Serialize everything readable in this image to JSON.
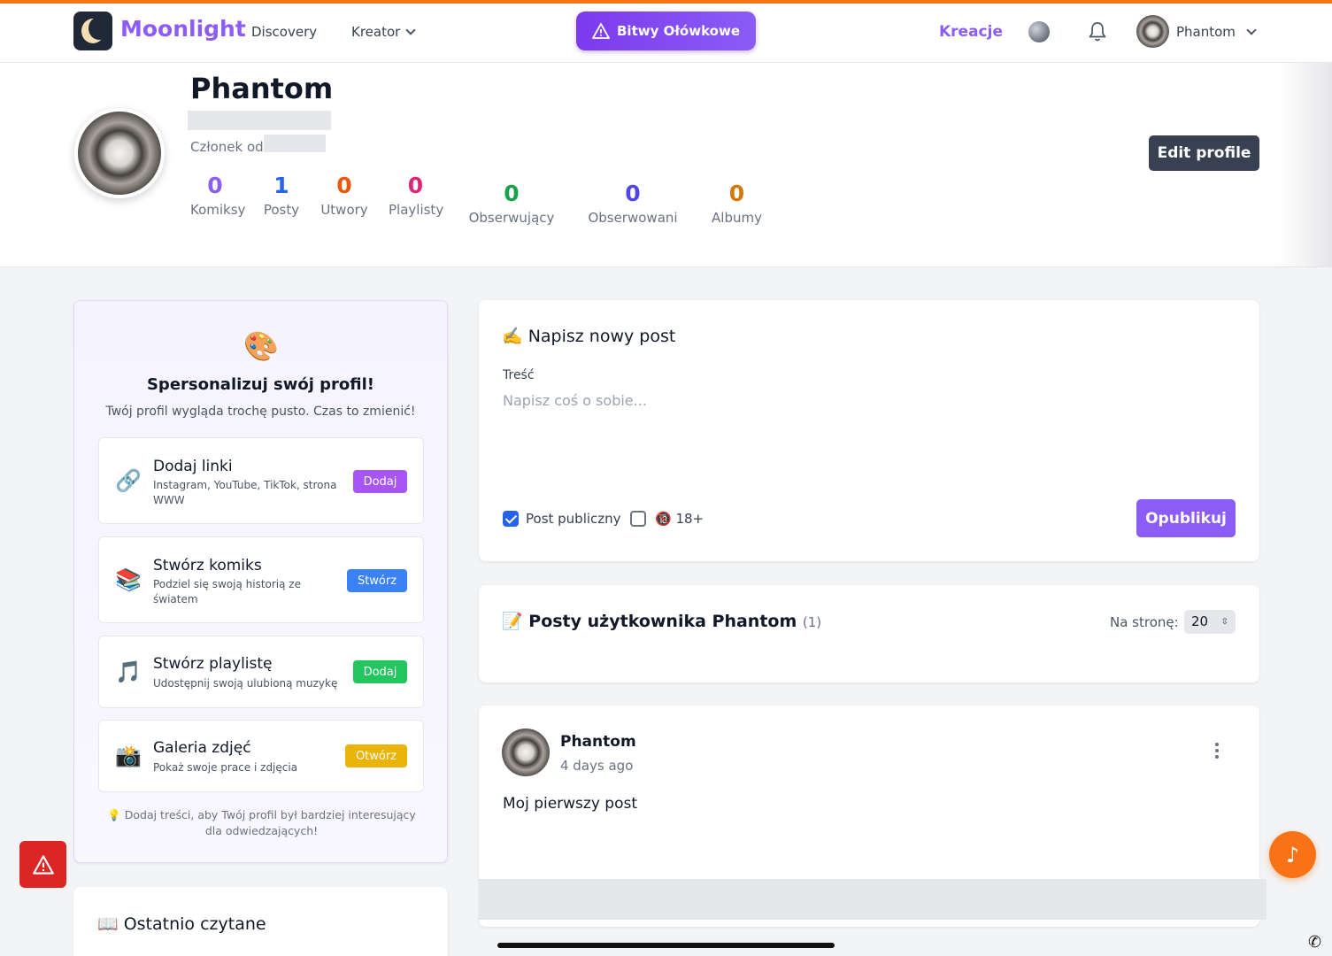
{
  "navbar": {
    "brand": "Moonlight",
    "links": [
      "Discovery",
      "Kreator"
    ],
    "battle_button": "Bitwy Ołówkowe",
    "kreacje": "Kreacje",
    "user_name": "Phantom"
  },
  "profile": {
    "name": "Phantom",
    "member_since_label": "Członek od",
    "edit_button": "Edit profile",
    "stats": [
      {
        "value": "0",
        "label": "Komiksy",
        "color": "#8b5cf6"
      },
      {
        "value": "1",
        "label": "Posty",
        "color": "#2563eb"
      },
      {
        "value": "0",
        "label": "Utwory",
        "color": "#ea580c"
      },
      {
        "value": "0",
        "label": "Playlisty",
        "color": "#db2777"
      },
      {
        "value": "0",
        "label": "Obserwujący",
        "color": "#16a34a"
      },
      {
        "value": "0",
        "label": "Obserwowani",
        "color": "#4f46e5"
      },
      {
        "value": "0",
        "label": "Albumy",
        "color": "#d97706"
      }
    ]
  },
  "personalize": {
    "icon": "🎨",
    "title": "Spersonalizuj swój profil!",
    "subtitle": "Twój profil wygląda trochę pusto. Czas to zmienić!",
    "items": [
      {
        "icon": "🔗",
        "title": "Dodaj linki",
        "desc": "Instagram, YouTube, TikTok, strona WWW",
        "button": "Dodaj",
        "color": "#a855f7"
      },
      {
        "icon": "📚",
        "title": "Stwórz komiks",
        "desc": "Podziel się swoją historią ze światem",
        "button": "Stwórz",
        "color": "#3b82f6"
      },
      {
        "icon": "🎵",
        "title": "Stwórz playlistę",
        "desc": "Udostępnij swoją ulubioną muzykę",
        "button": "Dodaj",
        "color": "#22c55e"
      },
      {
        "icon": "📸",
        "title": "Galeria zdjęć",
        "desc": "Pokaż swoje prace i zdjęcia",
        "button": "Otwórz",
        "color": "#eab308"
      }
    ],
    "tip": "💡 Dodaj treści, aby Twój profil był bardziej interesujący dla odwiedzających!"
  },
  "recent": {
    "title": "📖 Ostatnio czytane"
  },
  "new_post": {
    "title": "✍️ Napisz nowy post",
    "content_label": "Treść",
    "placeholder": "Napisz coś o sobie...",
    "public_label": "Post publiczny",
    "adult_label": "🔞 18+",
    "publish_button": "Opublikuj"
  },
  "posts": {
    "title": "📝 Posty użytkownika Phantom",
    "count": "(1)",
    "per_page_label": "Na stronę:",
    "per_page_value": "20"
  },
  "feed": [
    {
      "author": "Phantom",
      "time": "4 days ago",
      "text": "Moj pierwszy post"
    }
  ]
}
